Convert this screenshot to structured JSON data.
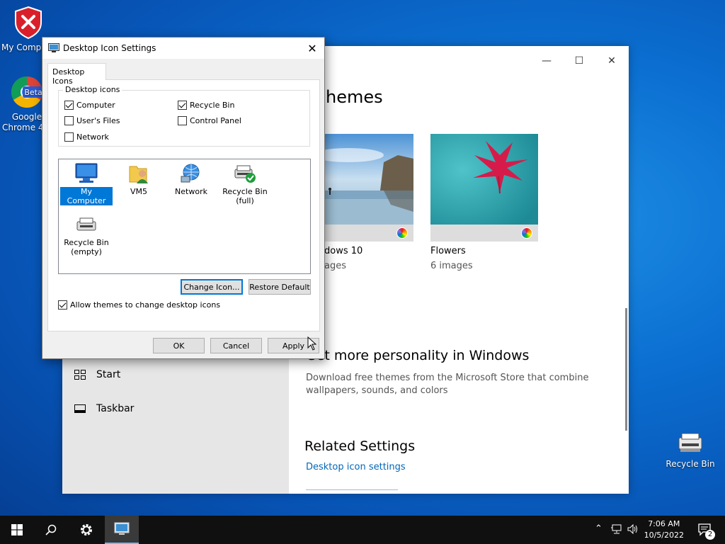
{
  "desktop": {
    "icons": [
      {
        "label": "My Compu"
      },
      {
        "label": "Google\nChrome 4..."
      },
      {
        "label": "Recycle Bin"
      }
    ],
    "beta_badge": "Beta"
  },
  "settings": {
    "heading": "hemes",
    "themes": [
      {
        "name": "dows 10",
        "count": "ages"
      },
      {
        "name": "Flowers",
        "count": "6 images"
      }
    ],
    "personality_heading": "Get more personality in Windows",
    "personality_text": "Download free themes from the Microsoft Store that combine wallpapers, sounds, and colors",
    "related_heading": "Related Settings",
    "related_link": "Desktop icon settings",
    "sidebar": [
      {
        "label": "Start"
      },
      {
        "label": "Taskbar"
      }
    ],
    "controls": {
      "minimize": "—",
      "maximize": "☐",
      "close": "✕"
    }
  },
  "dialog": {
    "title": "Desktop Icon Settings",
    "tab": "Desktop Icons",
    "group_label": "Desktop icons",
    "checkboxes": [
      {
        "label": "Computer",
        "checked": true
      },
      {
        "label": "Recycle Bin",
        "checked": true
      },
      {
        "label": "User's Files",
        "checked": false
      },
      {
        "label": "Control Panel",
        "checked": false
      },
      {
        "label": "Network",
        "checked": false
      }
    ],
    "icon_list": [
      {
        "label": "My Computer",
        "selected": true
      },
      {
        "label": "VM5",
        "selected": false
      },
      {
        "label": "Network",
        "selected": false
      },
      {
        "label": "Recycle Bin\n(full)",
        "selected": false
      },
      {
        "label": "Recycle Bin\n(empty)",
        "selected": false
      }
    ],
    "change_icon": "Change Icon...",
    "restore_default": "Restore Default",
    "allow_themes": {
      "label": "Allow themes to change desktop icons",
      "checked": true
    },
    "ok": "OK",
    "cancel": "Cancel",
    "apply": "Apply"
  },
  "taskbar": {
    "time": "7:06 AM",
    "date": "10/5/2022",
    "notifications": "2"
  }
}
